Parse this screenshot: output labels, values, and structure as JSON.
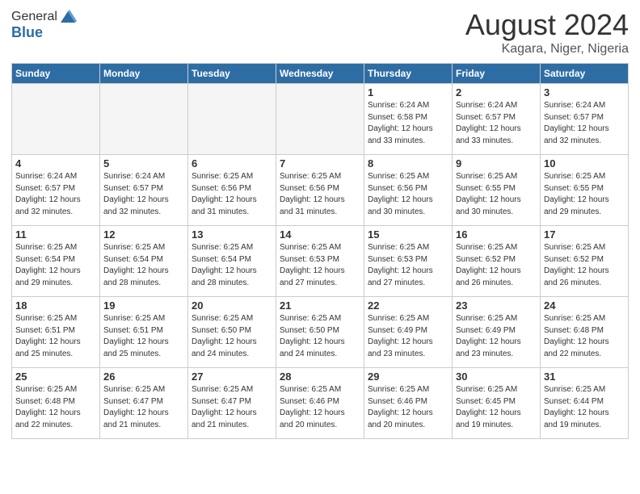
{
  "logo": {
    "general": "General",
    "blue": "Blue"
  },
  "title": "August 2024",
  "location": "Kagara, Niger, Nigeria",
  "days_of_week": [
    "Sunday",
    "Monday",
    "Tuesday",
    "Wednesday",
    "Thursday",
    "Friday",
    "Saturday"
  ],
  "weeks": [
    [
      {
        "day": "",
        "info": ""
      },
      {
        "day": "",
        "info": ""
      },
      {
        "day": "",
        "info": ""
      },
      {
        "day": "",
        "info": ""
      },
      {
        "day": "1",
        "info": "Sunrise: 6:24 AM\nSunset: 6:58 PM\nDaylight: 12 hours\nand 33 minutes."
      },
      {
        "day": "2",
        "info": "Sunrise: 6:24 AM\nSunset: 6:57 PM\nDaylight: 12 hours\nand 33 minutes."
      },
      {
        "day": "3",
        "info": "Sunrise: 6:24 AM\nSunset: 6:57 PM\nDaylight: 12 hours\nand 32 minutes."
      }
    ],
    [
      {
        "day": "4",
        "info": "Sunrise: 6:24 AM\nSunset: 6:57 PM\nDaylight: 12 hours\nand 32 minutes."
      },
      {
        "day": "5",
        "info": "Sunrise: 6:24 AM\nSunset: 6:57 PM\nDaylight: 12 hours\nand 32 minutes."
      },
      {
        "day": "6",
        "info": "Sunrise: 6:25 AM\nSunset: 6:56 PM\nDaylight: 12 hours\nand 31 minutes."
      },
      {
        "day": "7",
        "info": "Sunrise: 6:25 AM\nSunset: 6:56 PM\nDaylight: 12 hours\nand 31 minutes."
      },
      {
        "day": "8",
        "info": "Sunrise: 6:25 AM\nSunset: 6:56 PM\nDaylight: 12 hours\nand 30 minutes."
      },
      {
        "day": "9",
        "info": "Sunrise: 6:25 AM\nSunset: 6:55 PM\nDaylight: 12 hours\nand 30 minutes."
      },
      {
        "day": "10",
        "info": "Sunrise: 6:25 AM\nSunset: 6:55 PM\nDaylight: 12 hours\nand 29 minutes."
      }
    ],
    [
      {
        "day": "11",
        "info": "Sunrise: 6:25 AM\nSunset: 6:54 PM\nDaylight: 12 hours\nand 29 minutes."
      },
      {
        "day": "12",
        "info": "Sunrise: 6:25 AM\nSunset: 6:54 PM\nDaylight: 12 hours\nand 28 minutes."
      },
      {
        "day": "13",
        "info": "Sunrise: 6:25 AM\nSunset: 6:54 PM\nDaylight: 12 hours\nand 28 minutes."
      },
      {
        "day": "14",
        "info": "Sunrise: 6:25 AM\nSunset: 6:53 PM\nDaylight: 12 hours\nand 27 minutes."
      },
      {
        "day": "15",
        "info": "Sunrise: 6:25 AM\nSunset: 6:53 PM\nDaylight: 12 hours\nand 27 minutes."
      },
      {
        "day": "16",
        "info": "Sunrise: 6:25 AM\nSunset: 6:52 PM\nDaylight: 12 hours\nand 26 minutes."
      },
      {
        "day": "17",
        "info": "Sunrise: 6:25 AM\nSunset: 6:52 PM\nDaylight: 12 hours\nand 26 minutes."
      }
    ],
    [
      {
        "day": "18",
        "info": "Sunrise: 6:25 AM\nSunset: 6:51 PM\nDaylight: 12 hours\nand 25 minutes."
      },
      {
        "day": "19",
        "info": "Sunrise: 6:25 AM\nSunset: 6:51 PM\nDaylight: 12 hours\nand 25 minutes."
      },
      {
        "day": "20",
        "info": "Sunrise: 6:25 AM\nSunset: 6:50 PM\nDaylight: 12 hours\nand 24 minutes."
      },
      {
        "day": "21",
        "info": "Sunrise: 6:25 AM\nSunset: 6:50 PM\nDaylight: 12 hours\nand 24 minutes."
      },
      {
        "day": "22",
        "info": "Sunrise: 6:25 AM\nSunset: 6:49 PM\nDaylight: 12 hours\nand 23 minutes."
      },
      {
        "day": "23",
        "info": "Sunrise: 6:25 AM\nSunset: 6:49 PM\nDaylight: 12 hours\nand 23 minutes."
      },
      {
        "day": "24",
        "info": "Sunrise: 6:25 AM\nSunset: 6:48 PM\nDaylight: 12 hours\nand 22 minutes."
      }
    ],
    [
      {
        "day": "25",
        "info": "Sunrise: 6:25 AM\nSunset: 6:48 PM\nDaylight: 12 hours\nand 22 minutes."
      },
      {
        "day": "26",
        "info": "Sunrise: 6:25 AM\nSunset: 6:47 PM\nDaylight: 12 hours\nand 21 minutes."
      },
      {
        "day": "27",
        "info": "Sunrise: 6:25 AM\nSunset: 6:47 PM\nDaylight: 12 hours\nand 21 minutes."
      },
      {
        "day": "28",
        "info": "Sunrise: 6:25 AM\nSunset: 6:46 PM\nDaylight: 12 hours\nand 20 minutes."
      },
      {
        "day": "29",
        "info": "Sunrise: 6:25 AM\nSunset: 6:46 PM\nDaylight: 12 hours\nand 20 minutes."
      },
      {
        "day": "30",
        "info": "Sunrise: 6:25 AM\nSunset: 6:45 PM\nDaylight: 12 hours\nand 19 minutes."
      },
      {
        "day": "31",
        "info": "Sunrise: 6:25 AM\nSunset: 6:44 PM\nDaylight: 12 hours\nand 19 minutes."
      }
    ]
  ]
}
